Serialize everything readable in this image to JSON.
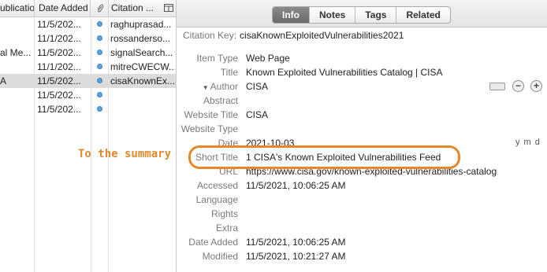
{
  "list": {
    "headers": {
      "publication": "ublication",
      "date_added": "Date Added",
      "attachment_icon": "paperclip-icon",
      "citation_key": "Citation ...",
      "column_picker_icon": "column-picker-icon"
    },
    "rows": [
      {
        "publication": "",
        "date_added": "11/5/202...",
        "has_dot": true,
        "citation_key": "raghuprasad..."
      },
      {
        "publication": "",
        "date_added": "11/1/202...",
        "has_dot": true,
        "citation_key": "rossanderso..."
      },
      {
        "publication": "al Me...",
        "date_added": "11/5/202...",
        "has_dot": true,
        "citation_key": "signalSearch..."
      },
      {
        "publication": "",
        "date_added": "11/1/202...",
        "has_dot": true,
        "citation_key": "mitreCWECW..."
      },
      {
        "publication": "A",
        "date_added": "11/5/202...",
        "has_dot": true,
        "citation_key": "cisaKnownEx...",
        "selected": true
      },
      {
        "publication": "",
        "date_added": "11/5/202...",
        "has_dot": true,
        "citation_key": ""
      },
      {
        "publication": "",
        "date_added": "11/5/202...",
        "has_dot": true,
        "citation_key": ""
      }
    ]
  },
  "tabs": [
    "Info",
    "Notes",
    "Tags",
    "Related"
  ],
  "active_tab": "Info",
  "citation_key": {
    "label": "Citation Key:",
    "value": "cisaKnownExploitedVulnerabilities2021"
  },
  "fields": {
    "item_type": {
      "label": "Item Type",
      "value": "Web Page"
    },
    "title": {
      "label": "Title",
      "value": "Known Exploited Vulnerabilities Catalog | CISA"
    },
    "author": {
      "label": "Author",
      "value": "CISA"
    },
    "abstract": {
      "label": "Abstract",
      "value": ""
    },
    "website_title": {
      "label": "Website Title",
      "value": "CISA"
    },
    "website_type": {
      "label": "Website Type",
      "value": ""
    },
    "date": {
      "label": "Date",
      "value": "2021-10-03",
      "ymd": "y m d"
    },
    "short_title": {
      "label": "Short Title",
      "value": "1 CISA's Known Exploited Vulnerabilities Feed"
    },
    "url": {
      "label": "URL",
      "value": "https://www.cisa.gov/known-exploited-vulnerabilities-catalog"
    },
    "accessed": {
      "label": "Accessed",
      "value": "11/5/2021, 10:06:25 AM"
    },
    "language": {
      "label": "Language",
      "value": ""
    },
    "rights": {
      "label": "Rights",
      "value": ""
    },
    "extra": {
      "label": "Extra",
      "value": ""
    },
    "date_added": {
      "label": "Date Added",
      "value": "11/5/2021, 10:06:25 AM"
    },
    "modified": {
      "label": "Modified",
      "value": "11/5/2021, 10:21:27 AM"
    }
  },
  "creator_controls": {
    "remove": "−",
    "add": "+"
  },
  "annotation": {
    "text": "To the summary",
    "color": "#e18a2c"
  },
  "colors": {
    "dot": "#5aa2de",
    "selected_row": "#dcdcdc",
    "highlight": "#e18a2c"
  }
}
